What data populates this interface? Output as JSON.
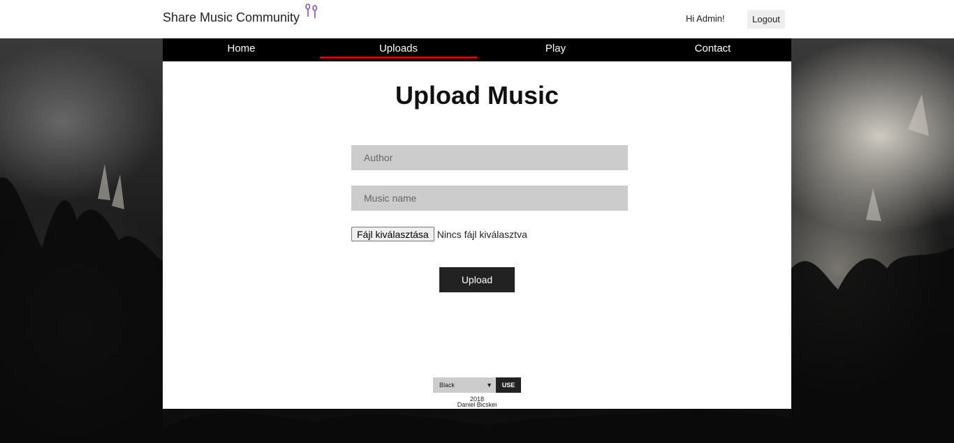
{
  "header": {
    "brand": "Share Music Community",
    "brand_icon": "earphones-icon",
    "greeting": "Hi Admin!",
    "logout_label": "Logout"
  },
  "nav": {
    "items": [
      {
        "label": "Home",
        "active": false
      },
      {
        "label": "Uploads",
        "active": true
      },
      {
        "label": "Play",
        "active": false
      },
      {
        "label": "Contact",
        "active": false
      }
    ],
    "active_color": "#dd0000"
  },
  "main": {
    "title": "Upload Music",
    "author_placeholder": "Author",
    "author_value": "",
    "music_name_placeholder": "Music name",
    "music_name_value": "",
    "file_button_label": "Fájl kiválasztása",
    "file_status": "Nincs fájl kiválasztva",
    "upload_label": "Upload"
  },
  "footer": {
    "theme_selected": "Black",
    "use_label": "USE",
    "year": "2018",
    "author": "Daniel Bicskei"
  }
}
